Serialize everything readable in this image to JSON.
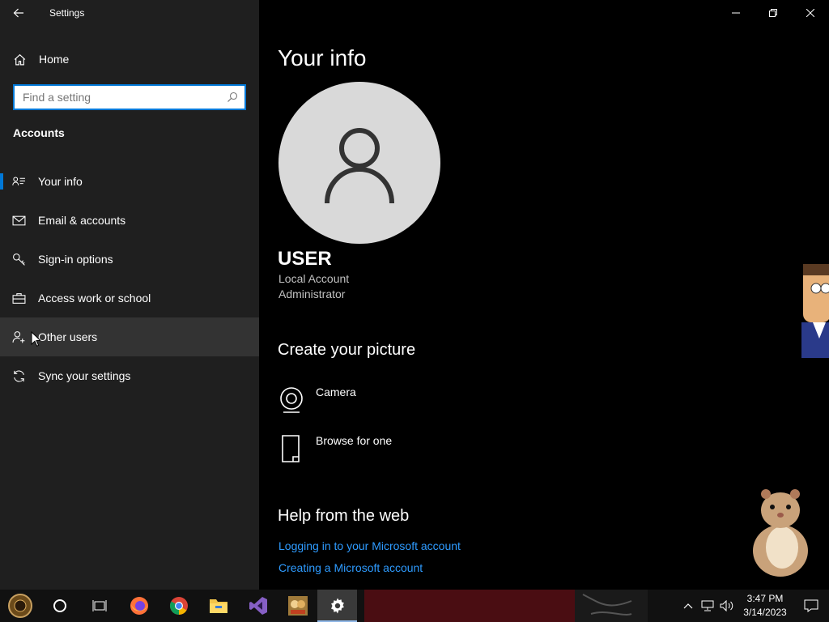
{
  "window": {
    "title": "Settings"
  },
  "sidebar": {
    "home_label": "Home",
    "search": {
      "placeholder": "Find a setting",
      "value": ""
    },
    "section_title": "Accounts",
    "items": [
      {
        "label": "Your info",
        "icon": "contact-card-icon",
        "selected": true
      },
      {
        "label": "Email & accounts",
        "icon": "mail-icon"
      },
      {
        "label": "Sign-in options",
        "icon": "key-icon"
      },
      {
        "label": "Access work or school",
        "icon": "briefcase-icon"
      },
      {
        "label": "Other users",
        "icon": "add-user-icon",
        "hovered": true
      },
      {
        "label": "Sync your settings",
        "icon": "sync-icon"
      }
    ]
  },
  "main": {
    "page_title": "Your info",
    "user": {
      "name": "USER",
      "account_type": "Local Account",
      "role": "Administrator"
    },
    "create_picture": {
      "title": "Create your picture",
      "options": [
        {
          "label": "Camera",
          "icon": "camera-icon"
        },
        {
          "label": "Browse for one",
          "icon": "file-icon"
        }
      ]
    },
    "help": {
      "title": "Help from the web",
      "links": [
        "Logging in to your Microsoft account",
        "Creating a Microsoft account"
      ]
    }
  },
  "taskbar": {
    "apps": [
      {
        "name": "start",
        "icon": "start-orb-icon"
      },
      {
        "name": "cortana",
        "icon": "cortana-circle-icon"
      },
      {
        "name": "task-view",
        "icon": "task-view-icon"
      },
      {
        "name": "firefox",
        "icon": "firefox-icon"
      },
      {
        "name": "chrome",
        "icon": "chrome-icon"
      },
      {
        "name": "file-explorer",
        "icon": "folder-icon"
      },
      {
        "name": "visual-studio",
        "icon": "visual-studio-icon"
      },
      {
        "name": "game",
        "icon": "game-icon"
      },
      {
        "name": "settings",
        "icon": "gear-icon",
        "active": true
      }
    ],
    "clock": {
      "time": "3:47 PM",
      "date": "3/14/2023"
    }
  },
  "colors": {
    "accent": "#0078d7",
    "link": "#2e9bff",
    "sidebar_bg": "#1f1f1f",
    "main_bg": "#000000"
  }
}
